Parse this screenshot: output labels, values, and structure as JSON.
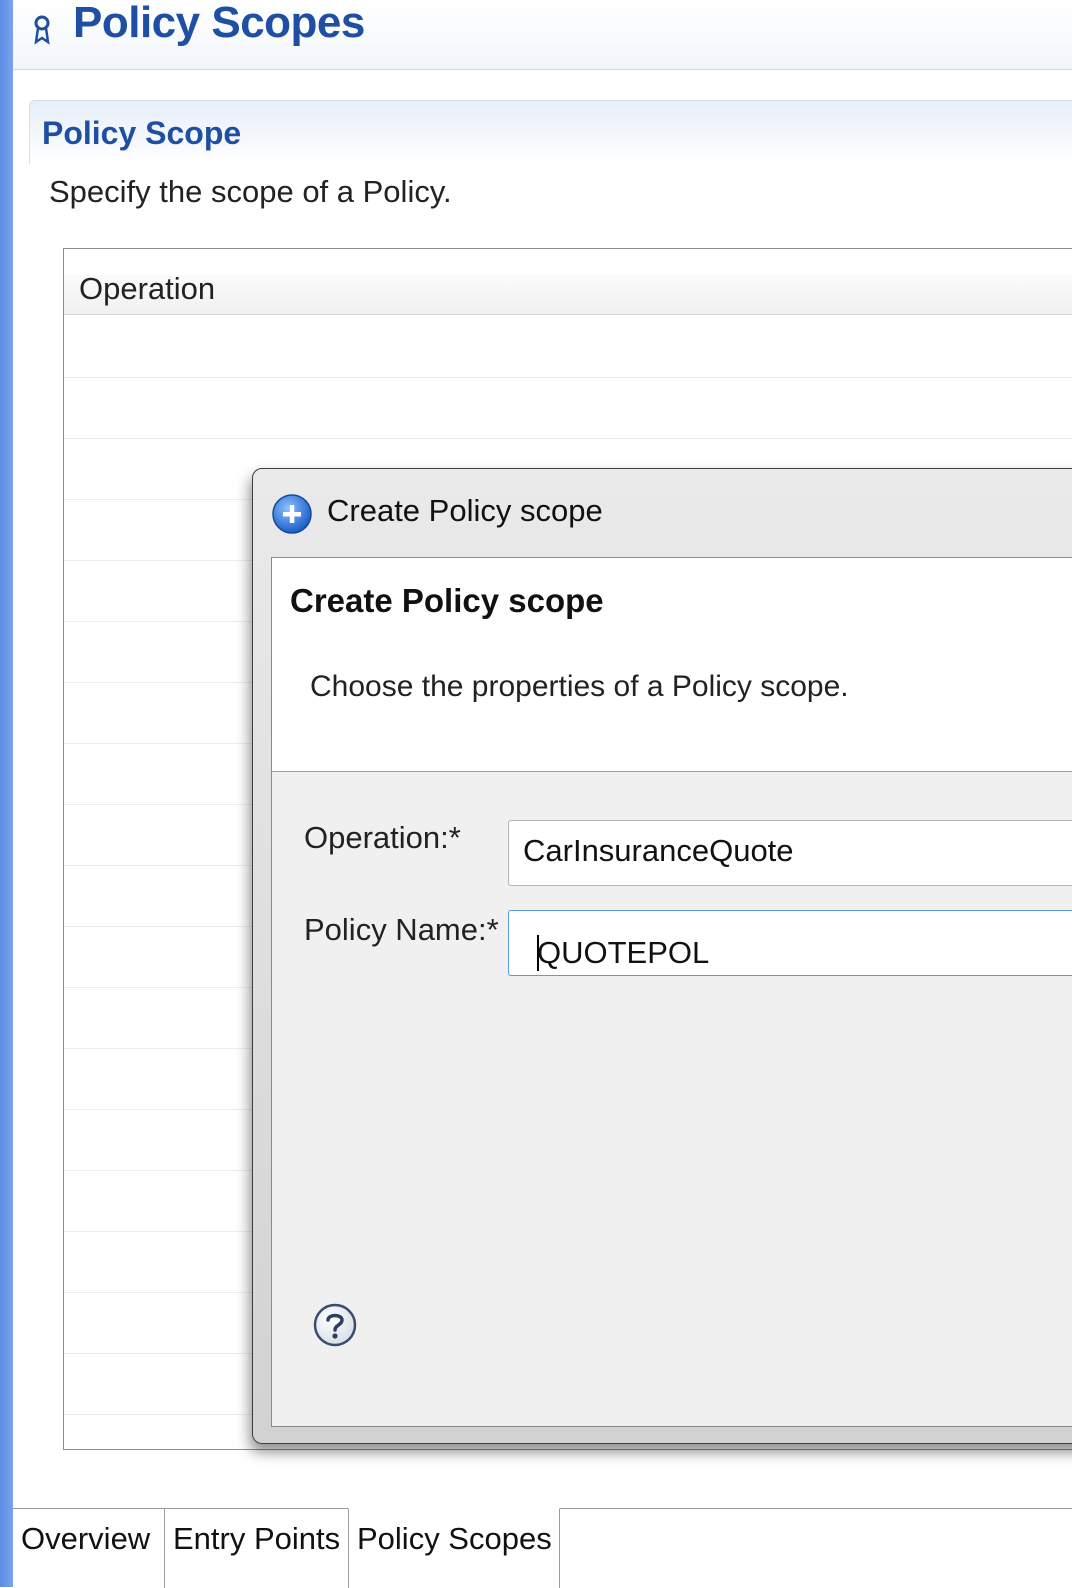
{
  "editor": {
    "title": "Policy Scopes",
    "section_title": "Policy Scope",
    "section_description": "Specify the scope of a Policy.",
    "table": {
      "columns": [
        "Operation"
      ]
    },
    "tabs": [
      {
        "label": "Overview",
        "active": false
      },
      {
        "label": "Entry Points",
        "active": false
      },
      {
        "label": "Policy Scopes",
        "active": true
      }
    ]
  },
  "dialog": {
    "window_title": "Create Policy scope",
    "banner_title": "Create Policy scope",
    "banner_description": "Choose the properties of a Policy scope.",
    "fields": {
      "operation": {
        "label": "Operation:*",
        "value": "CarInsuranceQuote"
      },
      "policy_name": {
        "label": "Policy Name:*",
        "value": "QUOTEPOL"
      }
    },
    "help_icon": "question-circle-icon"
  },
  "colors": {
    "accent": "#1f4fa3",
    "left_strip": "#5b8ee6",
    "focus": "#569de5"
  }
}
